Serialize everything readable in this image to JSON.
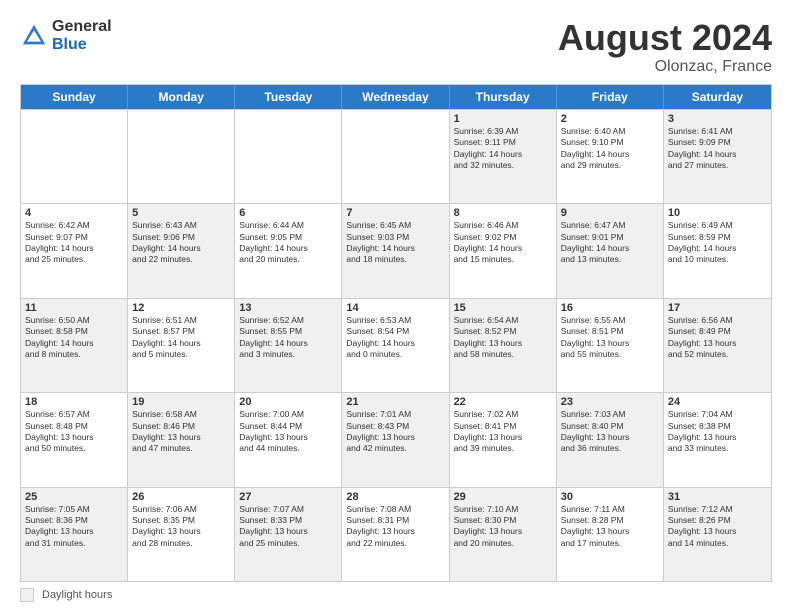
{
  "header": {
    "logo_general": "General",
    "logo_blue": "Blue",
    "month_title": "August 2024",
    "location": "Olonzac, France"
  },
  "footer": {
    "daylight_label": "Daylight hours"
  },
  "days_of_week": [
    "Sunday",
    "Monday",
    "Tuesday",
    "Wednesday",
    "Thursday",
    "Friday",
    "Saturday"
  ],
  "weeks": [
    [
      {
        "day": "",
        "info": "",
        "shaded": false
      },
      {
        "day": "",
        "info": "",
        "shaded": false
      },
      {
        "day": "",
        "info": "",
        "shaded": false
      },
      {
        "day": "",
        "info": "",
        "shaded": false
      },
      {
        "day": "1",
        "info": "Sunrise: 6:39 AM\nSunset: 9:11 PM\nDaylight: 14 hours\nand 32 minutes.",
        "shaded": true
      },
      {
        "day": "2",
        "info": "Sunrise: 6:40 AM\nSunset: 9:10 PM\nDaylight: 14 hours\nand 29 minutes.",
        "shaded": false
      },
      {
        "day": "3",
        "info": "Sunrise: 6:41 AM\nSunset: 9:09 PM\nDaylight: 14 hours\nand 27 minutes.",
        "shaded": true
      }
    ],
    [
      {
        "day": "4",
        "info": "Sunrise: 6:42 AM\nSunset: 9:07 PM\nDaylight: 14 hours\nand 25 minutes.",
        "shaded": false
      },
      {
        "day": "5",
        "info": "Sunrise: 6:43 AM\nSunset: 9:06 PM\nDaylight: 14 hours\nand 22 minutes.",
        "shaded": true
      },
      {
        "day": "6",
        "info": "Sunrise: 6:44 AM\nSunset: 9:05 PM\nDaylight: 14 hours\nand 20 minutes.",
        "shaded": false
      },
      {
        "day": "7",
        "info": "Sunrise: 6:45 AM\nSunset: 9:03 PM\nDaylight: 14 hours\nand 18 minutes.",
        "shaded": true
      },
      {
        "day": "8",
        "info": "Sunrise: 6:46 AM\nSunset: 9:02 PM\nDaylight: 14 hours\nand 15 minutes.",
        "shaded": false
      },
      {
        "day": "9",
        "info": "Sunrise: 6:47 AM\nSunset: 9:01 PM\nDaylight: 14 hours\nand 13 minutes.",
        "shaded": true
      },
      {
        "day": "10",
        "info": "Sunrise: 6:49 AM\nSunset: 8:59 PM\nDaylight: 14 hours\nand 10 minutes.",
        "shaded": false
      }
    ],
    [
      {
        "day": "11",
        "info": "Sunrise: 6:50 AM\nSunset: 8:58 PM\nDaylight: 14 hours\nand 8 minutes.",
        "shaded": true
      },
      {
        "day": "12",
        "info": "Sunrise: 6:51 AM\nSunset: 8:57 PM\nDaylight: 14 hours\nand 5 minutes.",
        "shaded": false
      },
      {
        "day": "13",
        "info": "Sunrise: 6:52 AM\nSunset: 8:55 PM\nDaylight: 14 hours\nand 3 minutes.",
        "shaded": true
      },
      {
        "day": "14",
        "info": "Sunrise: 6:53 AM\nSunset: 8:54 PM\nDaylight: 14 hours\nand 0 minutes.",
        "shaded": false
      },
      {
        "day": "15",
        "info": "Sunrise: 6:54 AM\nSunset: 8:52 PM\nDaylight: 13 hours\nand 58 minutes.",
        "shaded": true
      },
      {
        "day": "16",
        "info": "Sunrise: 6:55 AM\nSunset: 8:51 PM\nDaylight: 13 hours\nand 55 minutes.",
        "shaded": false
      },
      {
        "day": "17",
        "info": "Sunrise: 6:56 AM\nSunset: 8:49 PM\nDaylight: 13 hours\nand 52 minutes.",
        "shaded": true
      }
    ],
    [
      {
        "day": "18",
        "info": "Sunrise: 6:57 AM\nSunset: 8:48 PM\nDaylight: 13 hours\nand 50 minutes.",
        "shaded": false
      },
      {
        "day": "19",
        "info": "Sunrise: 6:58 AM\nSunset: 8:46 PM\nDaylight: 13 hours\nand 47 minutes.",
        "shaded": true
      },
      {
        "day": "20",
        "info": "Sunrise: 7:00 AM\nSunset: 8:44 PM\nDaylight: 13 hours\nand 44 minutes.",
        "shaded": false
      },
      {
        "day": "21",
        "info": "Sunrise: 7:01 AM\nSunset: 8:43 PM\nDaylight: 13 hours\nand 42 minutes.",
        "shaded": true
      },
      {
        "day": "22",
        "info": "Sunrise: 7:02 AM\nSunset: 8:41 PM\nDaylight: 13 hours\nand 39 minutes.",
        "shaded": false
      },
      {
        "day": "23",
        "info": "Sunrise: 7:03 AM\nSunset: 8:40 PM\nDaylight: 13 hours\nand 36 minutes.",
        "shaded": true
      },
      {
        "day": "24",
        "info": "Sunrise: 7:04 AM\nSunset: 8:38 PM\nDaylight: 13 hours\nand 33 minutes.",
        "shaded": false
      }
    ],
    [
      {
        "day": "25",
        "info": "Sunrise: 7:05 AM\nSunset: 8:36 PM\nDaylight: 13 hours\nand 31 minutes.",
        "shaded": true
      },
      {
        "day": "26",
        "info": "Sunrise: 7:06 AM\nSunset: 8:35 PM\nDaylight: 13 hours\nand 28 minutes.",
        "shaded": false
      },
      {
        "day": "27",
        "info": "Sunrise: 7:07 AM\nSunset: 8:33 PM\nDaylight: 13 hours\nand 25 minutes.",
        "shaded": true
      },
      {
        "day": "28",
        "info": "Sunrise: 7:08 AM\nSunset: 8:31 PM\nDaylight: 13 hours\nand 22 minutes.",
        "shaded": false
      },
      {
        "day": "29",
        "info": "Sunrise: 7:10 AM\nSunset: 8:30 PM\nDaylight: 13 hours\nand 20 minutes.",
        "shaded": true
      },
      {
        "day": "30",
        "info": "Sunrise: 7:11 AM\nSunset: 8:28 PM\nDaylight: 13 hours\nand 17 minutes.",
        "shaded": false
      },
      {
        "day": "31",
        "info": "Sunrise: 7:12 AM\nSunset: 8:26 PM\nDaylight: 13 hours\nand 14 minutes.",
        "shaded": true
      }
    ]
  ]
}
